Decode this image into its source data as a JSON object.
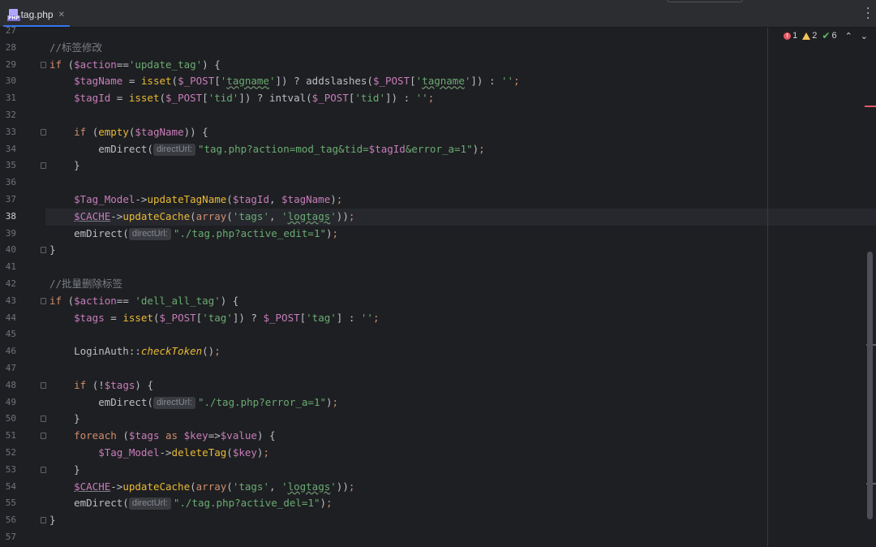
{
  "tab": {
    "icon": "php-file-icon",
    "filename": "tag.php",
    "close": "✕"
  },
  "inspections": {
    "errors": "1",
    "warnings": "2",
    "weak_warnings": "6"
  },
  "lines": [
    {
      "n": "27",
      "parts": []
    },
    {
      "n": "28",
      "parts": [
        {
          "c": "cmt",
          "t": "//标签修改"
        }
      ]
    },
    {
      "n": "29",
      "fold": true,
      "parts": [
        {
          "c": "kw",
          "t": "if "
        },
        {
          "c": "plain",
          "t": "("
        },
        {
          "c": "var",
          "t": "$action"
        },
        {
          "c": "plain",
          "t": "=="
        },
        {
          "c": "str",
          "t": "'update_tag'"
        },
        {
          "c": "plain",
          "t": ") {"
        }
      ]
    },
    {
      "n": "30",
      "parts": [
        {
          "c": "plain",
          "t": "    "
        },
        {
          "c": "var",
          "t": "$tagName"
        },
        {
          "c": "plain",
          "t": " = "
        },
        {
          "c": "fn",
          "t": "isset"
        },
        {
          "c": "plain",
          "t": "("
        },
        {
          "c": "var",
          "t": "$_POST"
        },
        {
          "c": "plain",
          "t": "["
        },
        {
          "c": "str",
          "t": "'"
        },
        {
          "c": "str wavy",
          "t": "tagname"
        },
        {
          "c": "str",
          "t": "'"
        },
        {
          "c": "plain",
          "t": "]) ? "
        },
        {
          "c": "plain",
          "t": "addslashes("
        },
        {
          "c": "var",
          "t": "$_POST"
        },
        {
          "c": "plain",
          "t": "["
        },
        {
          "c": "str",
          "t": "'"
        },
        {
          "c": "str wavy",
          "t": "tagname"
        },
        {
          "c": "str",
          "t": "'"
        },
        {
          "c": "plain",
          "t": "]) : "
        },
        {
          "c": "str",
          "t": "''"
        },
        {
          "c": "kw",
          "t": ";"
        }
      ]
    },
    {
      "n": "31",
      "parts": [
        {
          "c": "plain",
          "t": "    "
        },
        {
          "c": "var",
          "t": "$tagId"
        },
        {
          "c": "plain",
          "t": " = "
        },
        {
          "c": "fn",
          "t": "isset"
        },
        {
          "c": "plain",
          "t": "("
        },
        {
          "c": "var",
          "t": "$_POST"
        },
        {
          "c": "plain",
          "t": "["
        },
        {
          "c": "str",
          "t": "'tid'"
        },
        {
          "c": "plain",
          "t": "]) ? "
        },
        {
          "c": "plain",
          "t": "intval("
        },
        {
          "c": "var",
          "t": "$_POST"
        },
        {
          "c": "plain",
          "t": "["
        },
        {
          "c": "str",
          "t": "'tid'"
        },
        {
          "c": "plain",
          "t": "]) : "
        },
        {
          "c": "str",
          "t": "''"
        },
        {
          "c": "kw",
          "t": ";"
        }
      ]
    },
    {
      "n": "32",
      "parts": []
    },
    {
      "n": "33",
      "fold": true,
      "parts": [
        {
          "c": "plain",
          "t": "    "
        },
        {
          "c": "kw",
          "t": "if "
        },
        {
          "c": "plain",
          "t": "("
        },
        {
          "c": "fn",
          "t": "empty"
        },
        {
          "c": "plain",
          "t": "("
        },
        {
          "c": "var",
          "t": "$tagName"
        },
        {
          "c": "plain",
          "t": ")) {"
        }
      ]
    },
    {
      "n": "34",
      "parts": [
        {
          "c": "plain",
          "t": "        emDirect("
        },
        {
          "c": "hint",
          "t": "directUrl:"
        },
        {
          "c": "str",
          "t": "\"tag.php?action=mod_tag&tid="
        },
        {
          "c": "var",
          "t": "$tagId"
        },
        {
          "c": "str",
          "t": "&error_a=1\""
        },
        {
          "c": "plain",
          "t": ")"
        },
        {
          "c": "kw",
          "t": ";"
        }
      ]
    },
    {
      "n": "35",
      "fold": true,
      "parts": [
        {
          "c": "plain",
          "t": "    }"
        }
      ]
    },
    {
      "n": "36",
      "parts": []
    },
    {
      "n": "37",
      "parts": [
        {
          "c": "plain",
          "t": "    "
        },
        {
          "c": "var",
          "t": "$Tag_Model"
        },
        {
          "c": "plain",
          "t": "->"
        },
        {
          "c": "fn",
          "t": "updateTagName"
        },
        {
          "c": "plain",
          "t": "("
        },
        {
          "c": "var",
          "t": "$tagId"
        },
        {
          "c": "plain",
          "t": ", "
        },
        {
          "c": "var",
          "t": "$tagName"
        },
        {
          "c": "plain",
          "t": ")"
        },
        {
          "c": "kw",
          "t": ";"
        }
      ]
    },
    {
      "n": "38",
      "cur": true,
      "parts": [
        {
          "c": "plain",
          "t": "    "
        },
        {
          "c": "var under",
          "t": "$CACHE"
        },
        {
          "c": "plain",
          "t": "->"
        },
        {
          "c": "fn",
          "t": "updateCache"
        },
        {
          "c": "plain",
          "t": "("
        },
        {
          "c": "kw",
          "t": "array"
        },
        {
          "c": "plain",
          "t": "("
        },
        {
          "c": "str",
          "t": "'tags'"
        },
        {
          "c": "plain",
          "t": ", "
        },
        {
          "c": "str",
          "t": "'"
        },
        {
          "c": "str wavy",
          "t": "logtags"
        },
        {
          "c": "str",
          "t": "'"
        },
        {
          "c": "plain",
          "t": "))"
        },
        {
          "c": "kw",
          "t": ";"
        }
      ]
    },
    {
      "n": "39",
      "parts": [
        {
          "c": "plain",
          "t": "    emDirect("
        },
        {
          "c": "hint",
          "t": "directUrl:"
        },
        {
          "c": "str",
          "t": "\"./tag.php?active_edit=1\""
        },
        {
          "c": "plain",
          "t": ")"
        },
        {
          "c": "kw",
          "t": ";"
        }
      ]
    },
    {
      "n": "40",
      "fold": true,
      "parts": [
        {
          "c": "plain",
          "t": "}"
        }
      ]
    },
    {
      "n": "41",
      "parts": []
    },
    {
      "n": "42",
      "parts": [
        {
          "c": "cmt",
          "t": "//批量删除标签"
        }
      ]
    },
    {
      "n": "43",
      "fold": true,
      "parts": [
        {
          "c": "kw",
          "t": "if "
        },
        {
          "c": "plain",
          "t": "("
        },
        {
          "c": "var",
          "t": "$action"
        },
        {
          "c": "plain",
          "t": "== "
        },
        {
          "c": "str",
          "t": "'dell_all_tag'"
        },
        {
          "c": "plain",
          "t": ") {"
        }
      ]
    },
    {
      "n": "44",
      "parts": [
        {
          "c": "plain",
          "t": "    "
        },
        {
          "c": "var",
          "t": "$tags"
        },
        {
          "c": "plain",
          "t": " = "
        },
        {
          "c": "fn",
          "t": "isset"
        },
        {
          "c": "plain",
          "t": "("
        },
        {
          "c": "var",
          "t": "$_POST"
        },
        {
          "c": "plain",
          "t": "["
        },
        {
          "c": "str",
          "t": "'tag'"
        },
        {
          "c": "plain",
          "t": "]) ? "
        },
        {
          "c": "var",
          "t": "$_POST"
        },
        {
          "c": "plain",
          "t": "["
        },
        {
          "c": "str",
          "t": "'tag'"
        },
        {
          "c": "plain",
          "t": "] : "
        },
        {
          "c": "str",
          "t": "''"
        },
        {
          "c": "kw",
          "t": ";"
        }
      ]
    },
    {
      "n": "45",
      "parts": []
    },
    {
      "n": "46",
      "parts": [
        {
          "c": "plain",
          "t": "    LoginAuth::"
        },
        {
          "c": "fn italic",
          "t": "checkToken"
        },
        {
          "c": "plain",
          "t": "()"
        },
        {
          "c": "kw",
          "t": ";"
        }
      ]
    },
    {
      "n": "47",
      "parts": []
    },
    {
      "n": "48",
      "fold": true,
      "parts": [
        {
          "c": "plain",
          "t": "    "
        },
        {
          "c": "kw",
          "t": "if "
        },
        {
          "c": "plain",
          "t": "(!"
        },
        {
          "c": "var",
          "t": "$tags"
        },
        {
          "c": "plain",
          "t": ") {"
        }
      ]
    },
    {
      "n": "49",
      "parts": [
        {
          "c": "plain",
          "t": "        emDirect("
        },
        {
          "c": "hint",
          "t": "directUrl:"
        },
        {
          "c": "str",
          "t": "\"./tag.php?error_a=1\""
        },
        {
          "c": "plain",
          "t": ")"
        },
        {
          "c": "kw",
          "t": ";"
        }
      ]
    },
    {
      "n": "50",
      "fold": true,
      "parts": [
        {
          "c": "plain",
          "t": "    }"
        }
      ]
    },
    {
      "n": "51",
      "fold": true,
      "parts": [
        {
          "c": "plain",
          "t": "    "
        },
        {
          "c": "kw",
          "t": "foreach "
        },
        {
          "c": "plain",
          "t": "("
        },
        {
          "c": "var",
          "t": "$tags"
        },
        {
          "c": "kw",
          "t": " as "
        },
        {
          "c": "var",
          "t": "$key"
        },
        {
          "c": "plain",
          "t": "=>"
        },
        {
          "c": "var",
          "t": "$value"
        },
        {
          "c": "plain",
          "t": ") {"
        }
      ]
    },
    {
      "n": "52",
      "parts": [
        {
          "c": "plain",
          "t": "        "
        },
        {
          "c": "var",
          "t": "$Tag_Model"
        },
        {
          "c": "plain",
          "t": "->"
        },
        {
          "c": "fn",
          "t": "deleteTag"
        },
        {
          "c": "plain",
          "t": "("
        },
        {
          "c": "var",
          "t": "$key"
        },
        {
          "c": "plain",
          "t": ")"
        },
        {
          "c": "kw",
          "t": ";"
        }
      ]
    },
    {
      "n": "53",
      "fold": true,
      "parts": [
        {
          "c": "plain",
          "t": "    }"
        }
      ]
    },
    {
      "n": "54",
      "parts": [
        {
          "c": "plain",
          "t": "    "
        },
        {
          "c": "var under",
          "t": "$CACHE"
        },
        {
          "c": "plain",
          "t": "->"
        },
        {
          "c": "fn",
          "t": "updateCache"
        },
        {
          "c": "plain",
          "t": "("
        },
        {
          "c": "kw",
          "t": "array"
        },
        {
          "c": "plain",
          "t": "("
        },
        {
          "c": "str",
          "t": "'tags'"
        },
        {
          "c": "plain",
          "t": ", "
        },
        {
          "c": "str",
          "t": "'"
        },
        {
          "c": "str wavy",
          "t": "logtags"
        },
        {
          "c": "str",
          "t": "'"
        },
        {
          "c": "plain",
          "t": "))"
        },
        {
          "c": "kw",
          "t": ";"
        }
      ]
    },
    {
      "n": "55",
      "parts": [
        {
          "c": "plain",
          "t": "    emDirect("
        },
        {
          "c": "hint",
          "t": "directUrl:"
        },
        {
          "c": "str",
          "t": "\"./tag.php?active_del=1\""
        },
        {
          "c": "plain",
          "t": ")"
        },
        {
          "c": "kw",
          "t": ";"
        }
      ]
    },
    {
      "n": "56",
      "fold": true,
      "parts": [
        {
          "c": "plain",
          "t": "}"
        }
      ]
    },
    {
      "n": "57",
      "parts": []
    }
  ]
}
